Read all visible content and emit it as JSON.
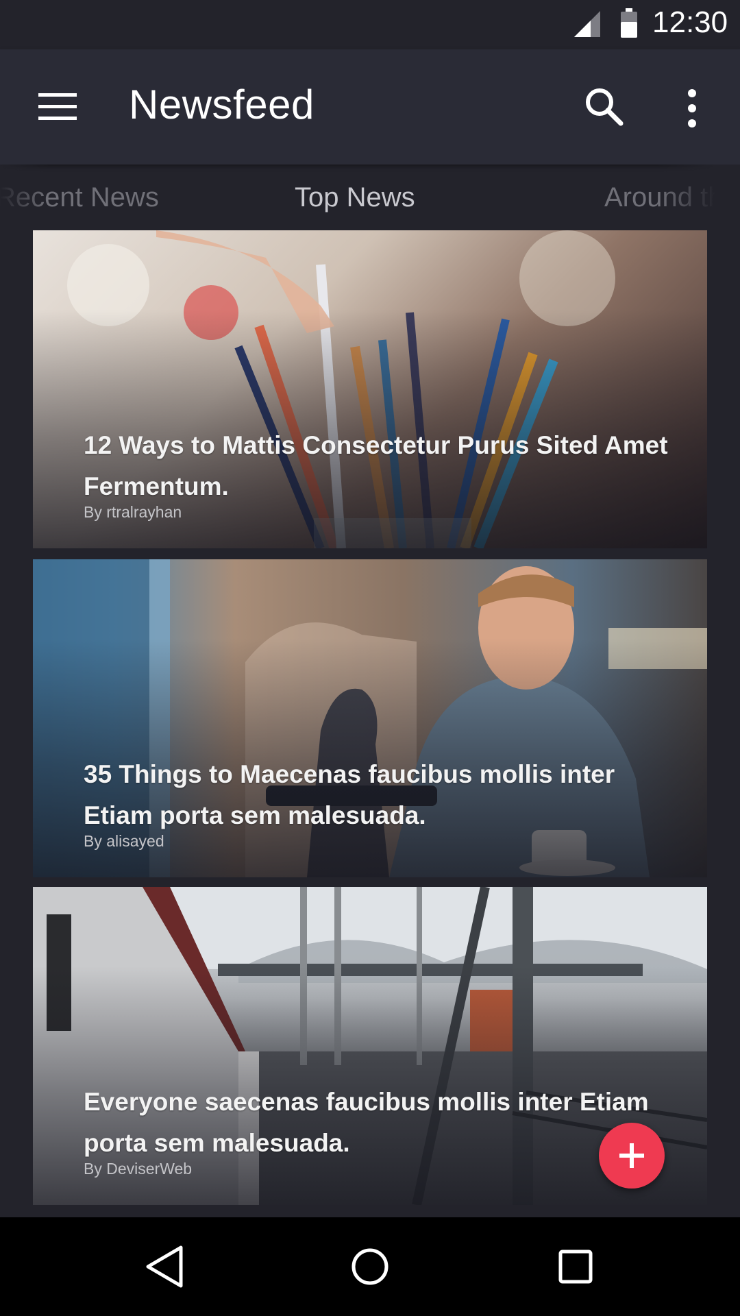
{
  "status_bar": {
    "time": "12:30",
    "icons": [
      "signal-icon",
      "battery-icon"
    ]
  },
  "app_bar": {
    "title": "Newsfeed",
    "icons": [
      "menu-icon",
      "search-icon",
      "more-vert-icon"
    ]
  },
  "tabs": [
    {
      "label": "Recent News",
      "selected": false
    },
    {
      "label": "Top News",
      "selected": true
    },
    {
      "label": "Around the World",
      "selected": false
    }
  ],
  "articles": [
    {
      "headline": "12 Ways to Mattis Consectetur Purus Sited Amet Fermentum.",
      "byline": "By rtralrayhan"
    },
    {
      "headline": "35 Things to Maecenas faucibus mollis inter Etiam porta sem malesuada.",
      "byline": "By alisayed"
    },
    {
      "headline": "Everyone saecenas faucibus mollis inter Etiam porta sem malesuada.",
      "byline": "By DeviserWeb"
    }
  ],
  "fab": {
    "icon": "plus-icon",
    "color": "#ef3a51"
  },
  "nav_bar": {
    "icons": [
      "back-icon",
      "home-icon",
      "recents-icon"
    ]
  },
  "colors": {
    "background": "#23232b",
    "app_bar": "#2a2b36",
    "accent": "#ef3a51"
  }
}
